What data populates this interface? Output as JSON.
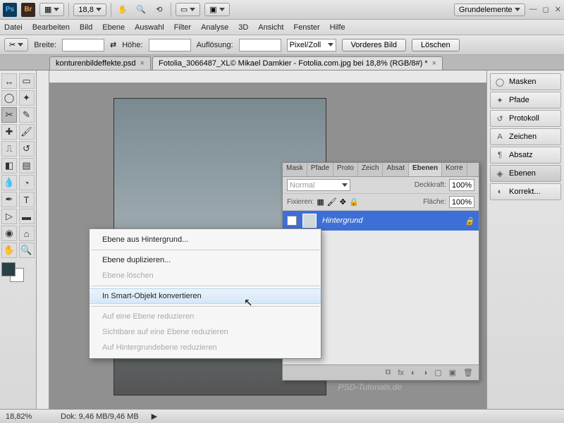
{
  "topbar": {
    "zoom_dropdown": "18,8",
    "workspace": "Grundelemente"
  },
  "menu": [
    "Datei",
    "Bearbeiten",
    "Bild",
    "Ebene",
    "Auswahl",
    "Filter",
    "Analyse",
    "3D",
    "Ansicht",
    "Fenster",
    "Hilfe"
  ],
  "options": {
    "breite": "Breite:",
    "hoehe": "Höhe:",
    "aufl": "Auflösung:",
    "unit": "Pixel/Zoll",
    "btn1": "Vorderes Bild",
    "btn2": "Löschen"
  },
  "tabs": [
    {
      "label": "konturenbildeffekte.psd",
      "active": false
    },
    {
      "label": "Fotolia_3066487_XL© Mikael Damkier - Fotolia.com.jpg bei 18,8% (RGB/8#) *",
      "active": true
    }
  ],
  "layers_panel": {
    "tabs": [
      "Mask",
      "Pfade",
      "Proto",
      "Zeich",
      "Absat",
      "Ebenen",
      "Korre"
    ],
    "active_tab": "Ebenen",
    "blend": "Normal",
    "opacity_label": "Deckkraft:",
    "opacity": "100%",
    "lock_label": "Fixieren:",
    "fill_label": "Fläche:",
    "fill": "100%",
    "layer_name": "Hintergrund"
  },
  "context_menu": [
    {
      "label": "Ebene aus Hintergrund...",
      "enabled": true
    },
    {
      "sep": true
    },
    {
      "label": "Ebene duplizieren...",
      "enabled": true
    },
    {
      "label": "Ebene löschen",
      "enabled": false
    },
    {
      "sep": true
    },
    {
      "label": "In Smart-Objekt konvertieren",
      "enabled": true,
      "hover": true
    },
    {
      "sep": true
    },
    {
      "label": "Auf eine Ebene reduzieren",
      "enabled": false
    },
    {
      "label": "Sichtbare auf eine Ebene reduzieren",
      "enabled": false
    },
    {
      "label": "Auf Hintergrundebene reduzieren",
      "enabled": false
    }
  ],
  "dock": [
    {
      "label": "Masken",
      "icon": "◯"
    },
    {
      "label": "Pfade",
      "icon": "✦"
    },
    {
      "label": "Protokoll",
      "icon": "↺"
    },
    {
      "label": "Zeichen",
      "icon": "A"
    },
    {
      "label": "Absatz",
      "icon": "¶"
    },
    {
      "label": "Ebenen",
      "icon": "◈",
      "sel": true
    },
    {
      "label": "Korrekt...",
      "icon": "◐"
    }
  ],
  "status": {
    "zoom": "18,82%",
    "doc": "Dok: 9,46 MB/9,46 MB"
  },
  "watermark": "PSD-Tutorials.de"
}
